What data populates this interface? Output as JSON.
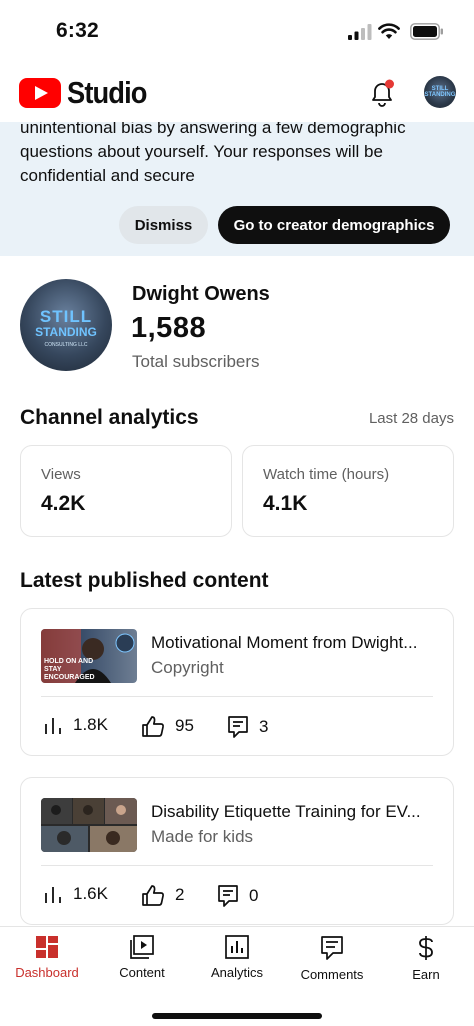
{
  "status_bar": {
    "time": "6:32"
  },
  "header": {
    "logo_text": "Studio",
    "avatar_text": "STILL STANDING"
  },
  "banner": {
    "text": "unintentional bias by answering a few demographic questions about yourself. Your responses will be confidential and secure",
    "dismiss_label": "Dismiss",
    "go_label": "Go to creator demographics",
    "background": "#eaf2f8"
  },
  "channel": {
    "avatar_line1": "STILL",
    "avatar_line2": "STANDING",
    "avatar_line3": "CONSULTING LLC",
    "name": "Dwight Owens",
    "subscriber_count": "1,588",
    "subscriber_label": "Total subscribers"
  },
  "analytics": {
    "title": "Channel analytics",
    "range": "Last 28 days",
    "metrics": [
      {
        "label": "Views",
        "value": "4.2K"
      },
      {
        "label": "Watch time (hours)",
        "value": "4.1K"
      }
    ]
  },
  "latest": {
    "title": "Latest published content",
    "videos": [
      {
        "title": "Motivational Moment from Dwight...",
        "subtitle": "Copyright",
        "thumb_text": "HOLD ON AND STAY ENCOURAGED",
        "views": "1.8K",
        "likes": "95",
        "comments": "3"
      },
      {
        "title": "Disability Etiquette Training for EV...",
        "subtitle": "Made for kids",
        "views": "1.6K",
        "likes": "2",
        "comments": "0"
      }
    ]
  },
  "nav": {
    "items": [
      {
        "label": "Dashboard",
        "icon": "dashboard-icon"
      },
      {
        "label": "Content",
        "icon": "content-icon"
      },
      {
        "label": "Analytics",
        "icon": "analytics-icon"
      },
      {
        "label": "Comments",
        "icon": "comments-icon"
      },
      {
        "label": "Earn",
        "icon": "earn-icon"
      }
    ],
    "active_color": "#c9302c"
  },
  "colors": {
    "brand_red": "#ff0000",
    "notification_dot": "#e53935"
  }
}
